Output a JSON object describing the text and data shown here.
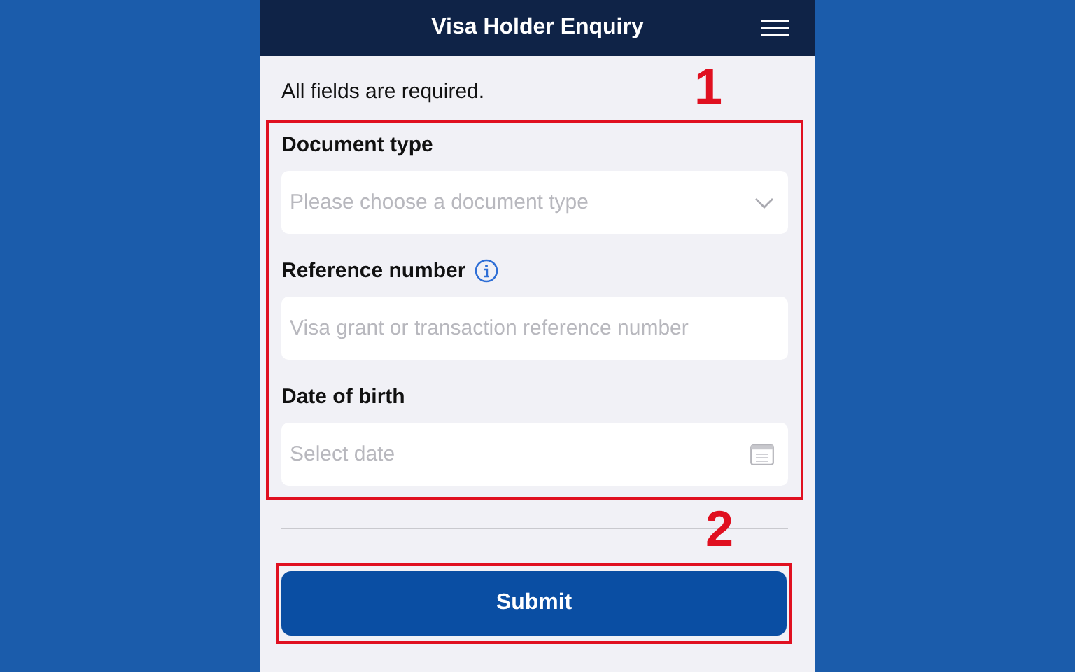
{
  "header": {
    "title": "Visa Holder Enquiry"
  },
  "intro": "All fields are required.",
  "fields": [
    {
      "kind": "select",
      "label": "Document type",
      "placeholder": "Please choose a document type",
      "info": false
    },
    {
      "kind": "text",
      "label": "Reference number",
      "placeholder": "Visa grant or transaction reference number",
      "info": true
    },
    {
      "kind": "date",
      "label": "Date of birth",
      "placeholder": "Select date",
      "info": false
    }
  ],
  "submit": "Submit",
  "annotations": [
    "1",
    "2"
  ]
}
